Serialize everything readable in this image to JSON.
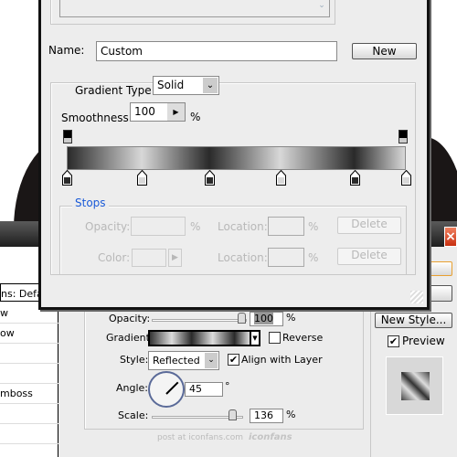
{
  "gradient_editor": {
    "name_label": "Name:",
    "name_value": "Custom",
    "new_button": "New",
    "gradient_type_label": "Gradient Type:",
    "gradient_type_value": "Solid",
    "smoothness_label": "Smoothness:",
    "smoothness_value": "100",
    "percent": "%",
    "gradient_stops_colors": [
      "#2a2a2a",
      "#d8d8d8",
      "#2a2a2a",
      "#d8d8d8",
      "#2a2a2a",
      "#d8d8d8"
    ],
    "stops": {
      "title": "Stops",
      "opacity_label": "Opacity:",
      "color_label": "Color:",
      "location_label": "Location:",
      "delete_label": "Delete",
      "percent": "%"
    }
  },
  "layer_style": {
    "close_icon": "close-icon",
    "list_items": [
      "ns: Default",
      "w",
      "ow",
      "",
      "",
      "mboss",
      "",
      ""
    ],
    "new_style_button": "New Style...",
    "preview_label": "Preview",
    "preview_checked": true,
    "opacity_label": "Opacity:",
    "opacity_value": "100",
    "opacity_percent": 100,
    "gradient_label": "Gradient:",
    "reverse_label": "Reverse",
    "reverse_checked": false,
    "style_label": "Style:",
    "style_value": "Reflected",
    "align_label": "Align with Layer",
    "align_checked": true,
    "angle_label": "Angle:",
    "angle_value": "45",
    "degree": "°",
    "scale_label": "Scale:",
    "scale_value": "136",
    "percent": "%"
  },
  "watermark": {
    "text": "post at iconfans.com",
    "logo": "iconfans"
  }
}
